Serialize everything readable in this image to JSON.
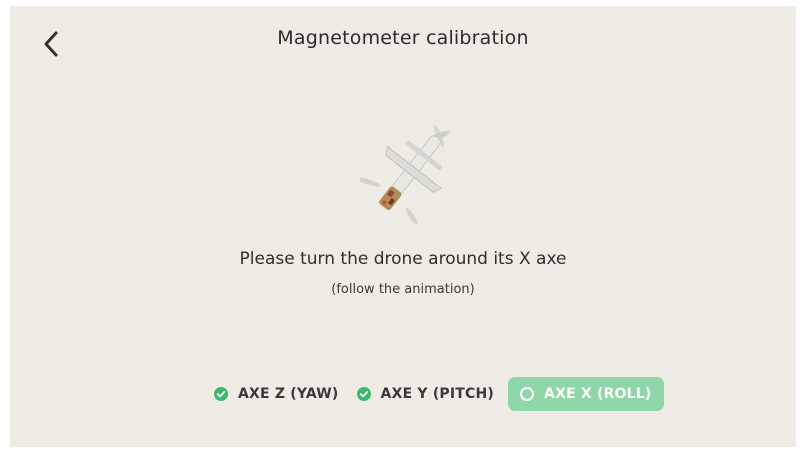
{
  "header": {
    "title": "Magnetometer calibration",
    "back_icon": "chevron-left-icon"
  },
  "main": {
    "instruction": "Please turn the drone around its X axe",
    "hint": "(follow the animation)"
  },
  "steps": [
    {
      "label": "AXE Z (YAW)",
      "status": "done",
      "icon": "check-circle-icon"
    },
    {
      "label": "AXE Y (PITCH)",
      "status": "done",
      "icon": "check-circle-icon"
    },
    {
      "label": "AXE X (ROLL)",
      "status": "in-progress",
      "icon": "empty-circle-icon"
    }
  ],
  "colors": {
    "background": "#efece5",
    "success": "#3cb96a",
    "active_step": "#8fd6a8",
    "text": "#2f2f2f"
  }
}
